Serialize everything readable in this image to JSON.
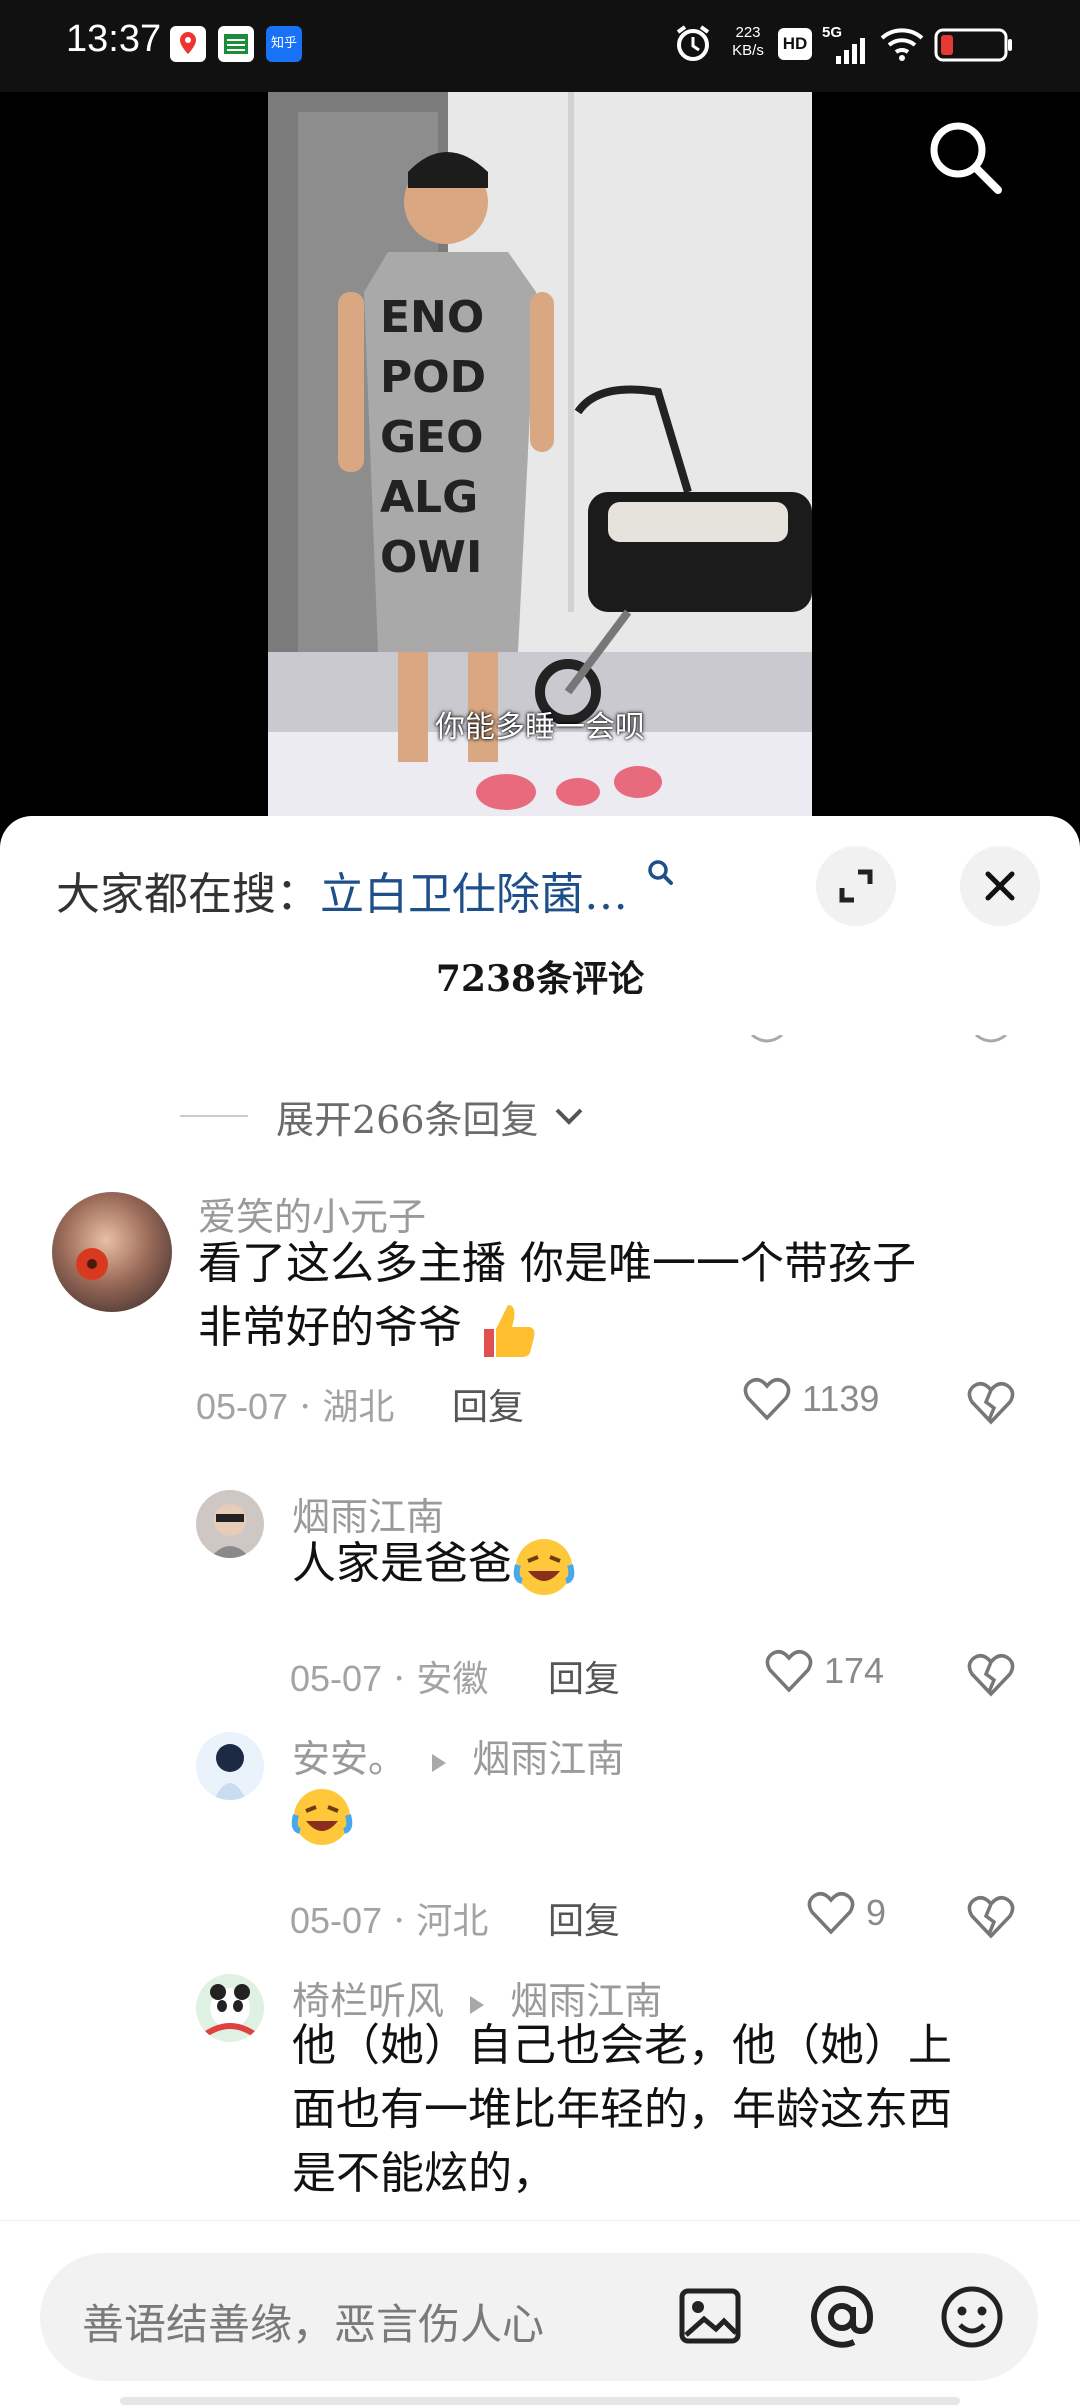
{
  "status_bar": {
    "time": "13:37",
    "notif_zhihu": "知乎",
    "net_speed_value": "223",
    "net_speed_unit": "KB/s",
    "hd_label": "HD",
    "network_label": "5G"
  },
  "video": {
    "subtitle": "你能多睡一会呗"
  },
  "sheet": {
    "trending_label": "大家都在搜：",
    "trending_term": "立白卫仕除菌…",
    "comment_count": "7238条评论",
    "expand_replies": "展开266条回复"
  },
  "comments": [
    {
      "user": "爱笑的小元子",
      "text_line1": "看了这么多主播 你是唯一一个带孩子",
      "text_line2": "非常好的爷爷",
      "emoji": "thumbs-up",
      "date": "05-07",
      "location": "湖北",
      "reply_label": "回复",
      "likes": "1139"
    },
    {
      "user": "烟雨江南",
      "text": "人家是爸爸",
      "emoji": "laughing-crying",
      "date": "05-07",
      "location": "安徽",
      "reply_label": "回复",
      "likes": "174"
    },
    {
      "user": "安安。",
      "reply_to": "烟雨江南",
      "emoji": "laughing-crying",
      "date": "05-07",
      "location": "河北",
      "reply_label": "回复",
      "likes": "9"
    },
    {
      "user": "椅栏听风",
      "reply_to": "烟雨江南",
      "text_line1": "他（她）自己也会老，他（她）上",
      "text_line2": "面也有一堆比年轻的，年龄这东西",
      "text_line3": "是不能炫的，"
    }
  ],
  "input": {
    "placeholder": "善语结善缘，恶言伤人心"
  },
  "colors": {
    "accent_link": "#1f4f8a",
    "muted_text": "#9a9a9a",
    "body_text": "#111111",
    "sheet_bg": "#ffffff"
  }
}
